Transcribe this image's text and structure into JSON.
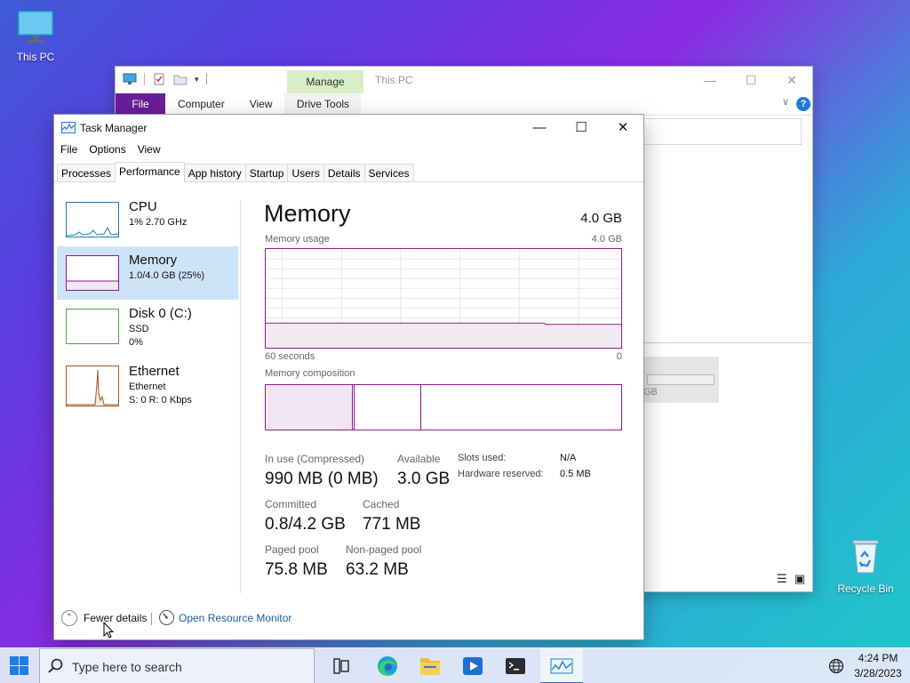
{
  "desktop": {
    "icons": [
      {
        "label": "This PC"
      },
      {
        "label": "Recycle Bin"
      }
    ]
  },
  "explorer": {
    "title": "This PC",
    "manage_label": "Manage",
    "tabs": [
      "File",
      "Computer",
      "View",
      "Drive Tools"
    ],
    "help_label": "?",
    "drive_text": "GB"
  },
  "task_manager": {
    "title": "Task Manager",
    "menu": [
      "File",
      "Options",
      "View"
    ],
    "tabs": [
      "Processes",
      "Performance",
      "App history",
      "Startup",
      "Users",
      "Details",
      "Services"
    ],
    "active_tab": "Performance",
    "sidebar": [
      {
        "name": "CPU",
        "sub1": "1% 2.70 GHz",
        "sub2": "",
        "color": "#1a7ab8"
      },
      {
        "name": "Memory",
        "sub1": "1.0/4.0 GB (25%)",
        "sub2": "",
        "color": "#8b1a8b"
      },
      {
        "name": "Disk 0 (C:)",
        "sub1": "SSD",
        "sub2": "0%",
        "color": "#4da93a"
      },
      {
        "name": "Ethernet",
        "sub1": "Ethernet",
        "sub2": "S: 0 R: 0 Kbps",
        "color": "#a3571a"
      }
    ],
    "performance": {
      "title": "Memory",
      "total": "4.0 GB",
      "usage_label": "Memory usage",
      "usage_max": "4.0 GB",
      "time_label": "60 seconds",
      "time_end": "0",
      "composition_label": "Memory composition",
      "usage_fraction": 0.25,
      "composition": {
        "in_use_fraction": 0.245,
        "modified_fraction": 0.005,
        "standby_fraction": 0.188
      },
      "stats": {
        "in_use_label": "In use (Compressed)",
        "in_use_value": "990 MB (0 MB)",
        "available_label": "Available",
        "available_value": "3.0 GB",
        "committed_label": "Committed",
        "committed_value": "0.8/4.2 GB",
        "cached_label": "Cached",
        "cached_value": "771 MB",
        "paged_label": "Paged pool",
        "paged_value": "75.8 MB",
        "nonpaged_label": "Non-paged pool",
        "nonpaged_value": "63.2 MB",
        "slots_label": "Slots used:",
        "slots_value": "N/A",
        "hw_label": "Hardware reserved:",
        "hw_value": "0.5 MB"
      }
    },
    "footer": {
      "fewer_details": "Fewer details",
      "open_resource_monitor": "Open Resource Monitor"
    }
  },
  "taskbar": {
    "search_placeholder": "Type here to search",
    "time": "4:24 PM",
    "date": "3/28/2023",
    "apps": [
      "task-view",
      "edge",
      "file-explorer",
      "media-player",
      "terminal",
      "task-manager"
    ],
    "active_app": "task-manager"
  },
  "colors": {
    "memory_accent": "#8b1a8b",
    "cpu_accent": "#1a7ab8",
    "disk_accent": "#4da93a",
    "ethernet_accent": "#a3571a",
    "explorer_file_tab": "#6a1d9a",
    "manage_tab": "#d8efc6",
    "selected_item": "#cce4f7",
    "link": "#1f5d9c"
  }
}
